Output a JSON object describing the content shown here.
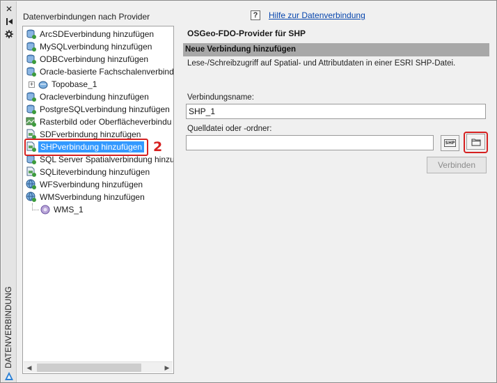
{
  "sidebar_strip": {
    "label": "DATENVERBINDUNG",
    "close_glyph": "✕",
    "buttons": [
      "close-icon",
      "auto-hide-icon",
      "settings-icon"
    ]
  },
  "tree_panel": {
    "title": "Datenverbindungen nach Provider",
    "items": [
      {
        "label": "ArcSDEverbindung hinzufügen",
        "icon": "database-connection-icon"
      },
      {
        "label": "MySQLverbindung hinzufügen",
        "icon": "database-connection-icon"
      },
      {
        "label": "ODBCverbindung hinzufügen",
        "icon": "database-connection-icon"
      },
      {
        "label": "Oracle-basierte Fachschalenverbind",
        "icon": "database-connection-icon"
      },
      {
        "label": "Topobase_1",
        "icon": "connection-node-icon",
        "expander": "+"
      },
      {
        "label": "Oracleverbindung hinzufügen",
        "icon": "database-connection-icon"
      },
      {
        "label": "PostgreSQLverbindung hinzufügen",
        "icon": "database-connection-icon"
      },
      {
        "label": "Rasterbild oder Oberflächeverbindu",
        "icon": "raster-connection-icon"
      },
      {
        "label": "SDFverbindung hinzufügen",
        "icon": "file-connection-icon"
      },
      {
        "label": "SHPverbindung hinzufügen",
        "icon": "file-connection-icon",
        "selected": true
      },
      {
        "label": "SQL Server Spatialverbindung hinzufü",
        "icon": "database-connection-icon"
      },
      {
        "label": "SQLiteverbindung hinzufügen",
        "icon": "file-connection-icon"
      },
      {
        "label": "WFSverbindung hinzufügen",
        "icon": "web-connection-icon"
      },
      {
        "label": "WMSverbindung hinzufügen",
        "icon": "web-connection-icon"
      },
      {
        "label": "WMS_1",
        "icon": "wms-node-icon"
      }
    ],
    "callout_number": "2"
  },
  "help": {
    "icon_glyph": "?",
    "link": "Hilfe zur Datenverbindung"
  },
  "provider": {
    "title": "OSGeo-FDO-Provider für SHP",
    "section": "Neue Verbindung hinzufügen",
    "description": "Lese-/Schreibzugriff auf Spatial- und Attributdaten in einer ESRI SHP-Datei."
  },
  "form": {
    "name_label": "Verbindungsname:",
    "name_value": "SHP_1",
    "source_label": "Quelldatei oder -ordner:",
    "source_value": "",
    "shp_button_text": "SHP",
    "connect_button": "Verbinden"
  },
  "colors": {
    "selection": "#3399ff",
    "highlight": "#d62020",
    "link": "#0645ad"
  }
}
